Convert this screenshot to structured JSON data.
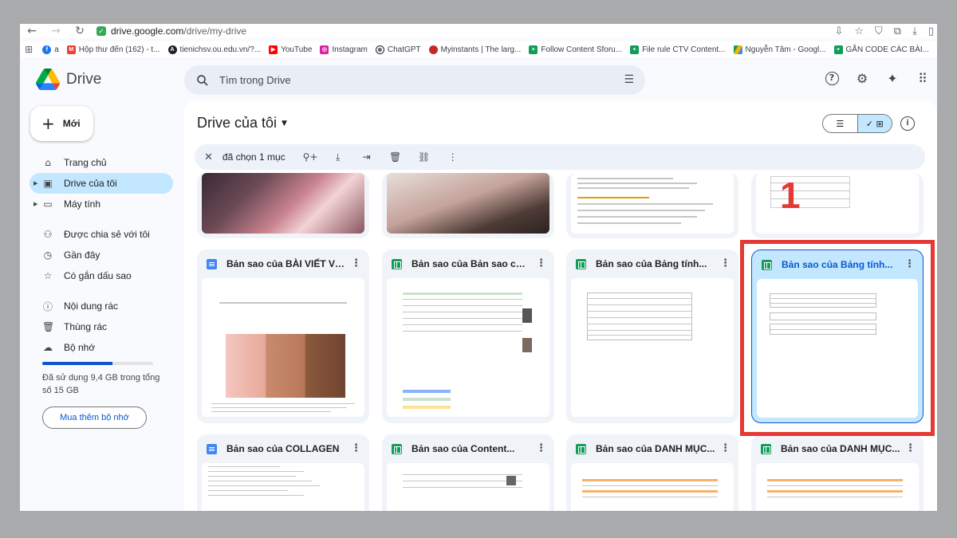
{
  "browser": {
    "url_host": "drive.google.com",
    "url_path": "/drive/my-drive",
    "bookmarks": [
      {
        "label": "a",
        "color": "#1877f2",
        "icon": "facebook-icon"
      },
      {
        "label": "Hộp thư đến (162) - t...",
        "color": "#ea4335",
        "icon": "gmail-icon"
      },
      {
        "label": "tienichsv.ou.edu.vn/?...",
        "color": "#202124",
        "icon": "site-icon"
      },
      {
        "label": "YouTube",
        "color": "#ff0000",
        "icon": "youtube-icon"
      },
      {
        "label": "Instagram",
        "color": "#d6249f",
        "icon": "instagram-icon"
      },
      {
        "label": "ChatGPT",
        "color": "#202124",
        "icon": "chatgpt-icon"
      },
      {
        "label": "Myinstants | The larg...",
        "color": "#c62828",
        "icon": "myinstants-icon"
      },
      {
        "label": "Follow Content Sforu...",
        "color": "#0f9d58",
        "icon": "sheets-icon"
      },
      {
        "label": "File rule CTV Content...",
        "color": "#0f9d58",
        "icon": "sheets-icon"
      },
      {
        "label": "Nguyễn Tâm - Googl...",
        "color": "#4285f4",
        "icon": "drive-icon"
      },
      {
        "label": "GẮN CODE CÁC BÀI...",
        "color": "#0f9d58",
        "icon": "sheets-icon"
      }
    ]
  },
  "header": {
    "app_name": "Drive",
    "search_placeholder": "Tìm trong Drive"
  },
  "sidebar": {
    "new_label": "Mới",
    "items": [
      {
        "label": "Trang chủ",
        "icon": "home-icon"
      },
      {
        "label": "Drive của tôi",
        "icon": "my-drive-icon",
        "active": true
      },
      {
        "label": "Máy tính",
        "icon": "computer-icon"
      },
      {
        "label": "Được chia sẻ với tôi",
        "icon": "shared-icon"
      },
      {
        "label": "Gần đây",
        "icon": "clock-icon"
      },
      {
        "label": "Có gắn dấu sao",
        "icon": "star-icon"
      },
      {
        "label": "Nội dung rác",
        "icon": "spam-icon"
      },
      {
        "label": "Thùng rác",
        "icon": "trash-icon"
      },
      {
        "label": "Bộ nhớ",
        "icon": "cloud-icon"
      }
    ],
    "storage_text": "Đã sử dụng 9,4 GB trong tổng số 15 GB",
    "storage_fraction": 0.63,
    "buy_label": "Mua thêm bộ nhớ"
  },
  "main": {
    "title": "Drive của tôi",
    "selection_text": "đã chọn 1 mục",
    "cards_row2": [
      {
        "name": "Bản sao của BÀI VIẾT VỀ M...",
        "type": "doc"
      },
      {
        "name": "Bản sao của Bản sao của...",
        "type": "sheet"
      },
      {
        "name": "Bản sao của Bảng tính...",
        "type": "sheet"
      },
      {
        "name": "Bản sao của Bảng tính...",
        "type": "sheet",
        "selected": true
      }
    ],
    "cards_row3": [
      {
        "name": "Bản sao của COLLAGEN",
        "type": "doc"
      },
      {
        "name": "Bản sao của Content...",
        "type": "sheet"
      },
      {
        "name": "Bản sao của DANH MỤC...",
        "type": "sheet"
      },
      {
        "name": "Bản sao của DANH MỤC...",
        "type": "sheet"
      }
    ]
  },
  "annotation": {
    "number": "1",
    "color": "#e53935"
  },
  "colors": {
    "accent": "#0b57d0",
    "selected_bg": "#c2e7ff"
  }
}
